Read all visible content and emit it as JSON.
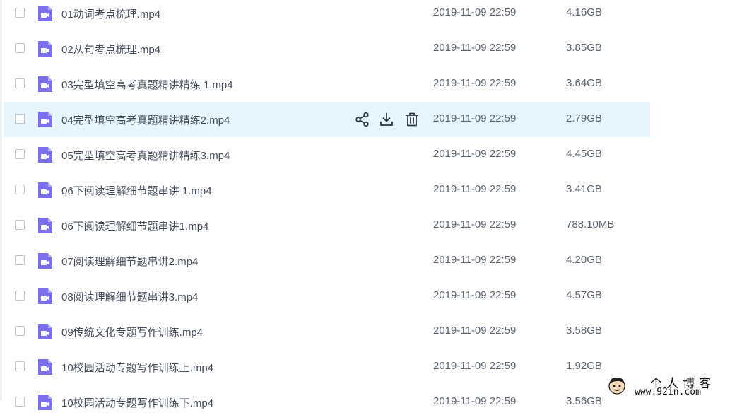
{
  "files": [
    {
      "name": "01动词考点梳理.mp4",
      "date": "2019-11-09 22:59",
      "size": "4.16GB"
    },
    {
      "name": "02从句考点梳理.mp4",
      "date": "2019-11-09 22:59",
      "size": "3.85GB"
    },
    {
      "name": "03完型填空高考真题精讲精练 1.mp4",
      "date": "2019-11-09 22:59",
      "size": "3.64GB"
    },
    {
      "name": "04完型填空高考真题精讲精练2.mp4",
      "date": "2019-11-09 22:59",
      "size": "2.79GB"
    },
    {
      "name": "05完型填空高考真题精讲精练3.mp4",
      "date": "2019-11-09 22:59",
      "size": "4.45GB"
    },
    {
      "name": "06下阅读理解细节题串讲 1.mp4",
      "date": "2019-11-09 22:59",
      "size": "3.41GB"
    },
    {
      "name": "06下阅读理解细节题串讲1.mp4",
      "date": "2019-11-09 22:59",
      "size": "788.10MB"
    },
    {
      "name": "07阅读理解细节题串讲2.mp4",
      "date": "2019-11-09 22:59",
      "size": "4.20GB"
    },
    {
      "name": "08阅读理解细节题串讲3.mp4",
      "date": "2019-11-09 22:59",
      "size": "4.57GB"
    },
    {
      "name": "09传统文化专题写作训练.mp4",
      "date": "2019-11-09 22:59",
      "size": "3.58GB"
    },
    {
      "name": "10校园活动专题写作训练上.mp4",
      "date": "2019-11-09 22:59",
      "size": "1.92GB"
    },
    {
      "name": "10校园活动专题写作训练下.mp4",
      "date": "2019-11-09 22:59",
      "size": "3.56GB"
    }
  ],
  "hovered_row_index": 3,
  "icons": {
    "file": "video-file-icon",
    "share": "share-icon",
    "download": "download-icon",
    "delete": "trash-icon"
  },
  "colors": {
    "file_icon": "#7b6ff0",
    "hover_row": "#e6f5fe"
  },
  "watermark": {
    "title": "个人博客",
    "url": "www.92in.com"
  }
}
